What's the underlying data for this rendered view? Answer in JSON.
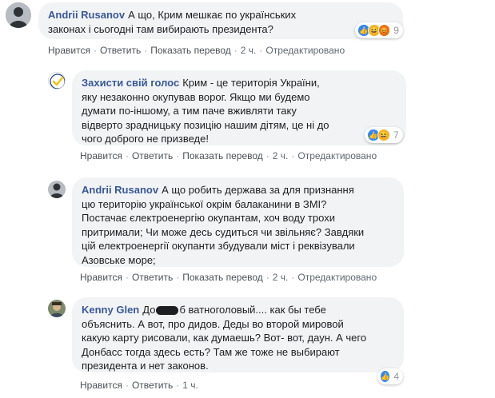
{
  "comments": [
    {
      "author": "Andrii Rusanov",
      "text_lines": [
        "А що, Крим мешкає по українських",
        "законах і сьогодні там вибирають президента?"
      ],
      "reaction_count": "9",
      "reaction_icons": [
        "like-icon",
        "haha-icon",
        "angry-icon"
      ],
      "actions": {
        "like": "Нравится",
        "reply": "Ответить",
        "translate": "Показать перевод",
        "time": "2 ч.",
        "edited": "Отредактировано"
      }
    },
    {
      "author": "Захисти свій голос",
      "text_lines": [
        "Крим - це територія України,",
        "яку незаконно окупував ворог. Якщо ми будемо",
        "думати по-іншому, а тим паче вживляти таку",
        "відверто зрадницьку позицію нашим дітям, це ні до",
        "чого доброго не призведе!"
      ],
      "reaction_count": "7",
      "reaction_icons": [
        "like-icon",
        "haha-icon"
      ],
      "actions": {
        "like": "Нравится",
        "reply": "Ответить",
        "translate": "Показать перевод",
        "time": "2 ч.",
        "edited": "Отредактировано"
      }
    },
    {
      "author": "Andrii Rusanov",
      "text_lines": [
        "А що робить держава за для признання",
        "цю територію української окрім балаканини в ЗМІ?",
        "Постачає єлектроенергію окупантам, хоч воду трохи",
        "притримали; Чи може десь судиться чи звільняє? Завдяки",
        "цій електроенергії окупанти збудували міст і реквізували",
        "Азовське море;"
      ],
      "actions": {
        "like": "Нравится",
        "reply": "Ответить",
        "translate": "Показать перевод",
        "time": "2 ч.",
        "edited": "Отредактировано"
      }
    },
    {
      "author": "Kenny Glen",
      "text_first_prefix": "До",
      "text_first_suffix": "б ватноголовый.... как бы тебе",
      "text_lines": [
        "объяснить. А вот, про дидов. Деды во второй мировой",
        "какую карту рисовали, как думаешь? Вот- вот, даун. А чего",
        "Донбасс тогда здесь есть? Там же тоже не выбирают",
        "президента и нет законов."
      ],
      "reaction_count": "4",
      "reaction_icons": [
        "like-icon"
      ],
      "actions": {
        "like": "Нравится",
        "reply": "Ответить",
        "time": "1 ч."
      }
    }
  ],
  "colors": {
    "author": "#385898",
    "bubble": "#f2f3f5",
    "like": "#2d88ff",
    "haha": "#f7b125",
    "angry": "#e9710f",
    "badge": "#f5c518"
  }
}
